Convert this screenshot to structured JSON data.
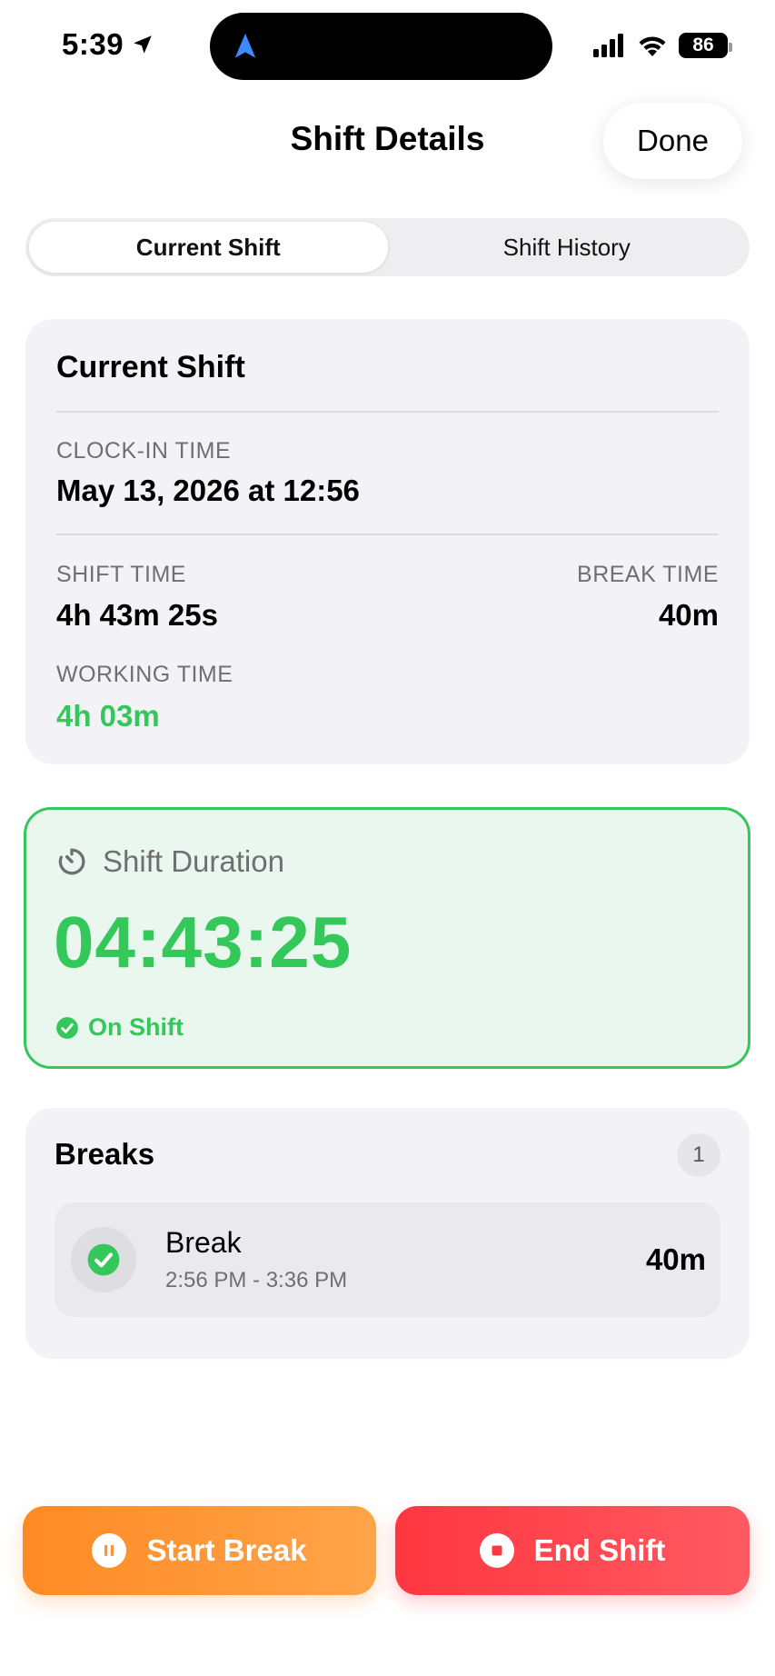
{
  "status_bar": {
    "time": "5:39",
    "battery": "86",
    "icons": [
      "location-arrow-icon",
      "navigation-icon",
      "cellular-signal-icon",
      "wifi-icon",
      "battery-icon"
    ]
  },
  "nav": {
    "title": "Shift Details",
    "done_label": "Done"
  },
  "tabs": [
    {
      "label": "Current Shift",
      "selected": true
    },
    {
      "label": "Shift History",
      "selected": false
    }
  ],
  "current_shift": {
    "title": "Current Shift",
    "clock_in_label": "CLOCK-IN TIME",
    "clock_in_value": "May 13, 2026 at 12:56",
    "shift_time_label": "SHIFT TIME",
    "shift_time_value": "4h 43m 25s",
    "break_time_label": "BREAK TIME",
    "break_time_value": "40m",
    "working_time_label": "WORKING TIME",
    "working_time_value": "4h 03m"
  },
  "duration": {
    "label": "Shift Duration",
    "value": "04:43:25",
    "status": "On Shift",
    "icon": "timer-icon"
  },
  "breaks": {
    "title": "Breaks",
    "count": "1",
    "items": [
      {
        "name": "Break",
        "range": "2:56 PM - 3:36 PM",
        "duration": "40m",
        "icon": "checkmark-circle-icon"
      }
    ]
  },
  "actions": {
    "start_break_label": "Start Break",
    "end_shift_label": "End Shift"
  },
  "colors": {
    "green": "#34c759",
    "orange": "#ff8a25",
    "red": "#ff3640",
    "card_bg": "#f3f3f7"
  }
}
